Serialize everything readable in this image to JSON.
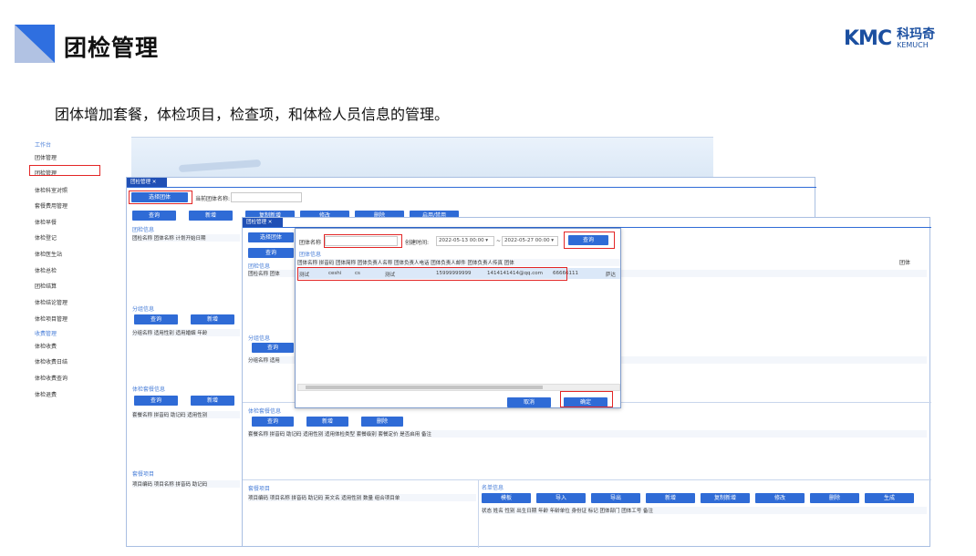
{
  "slide": {
    "title": "团检管理",
    "subtitle": "团体增加套餐，体检项目，检查项，和体检人员信息的管理。",
    "logo": {
      "mark": "KMC",
      "cn": "科玛奇",
      "en": "KEMUCH"
    }
  },
  "colors": {
    "accent": "#2f6fe0",
    "button": "#2f6bd6",
    "highlight": "#e32626"
  },
  "menu": {
    "items": [
      "工作台",
      "团体管理",
      "团检管理",
      "体检科室对照",
      "套餐费用管理",
      "体检早餐",
      "体检登记",
      "体检医生站",
      "体检总检",
      "团检结算",
      "体检结论管理",
      "体检项目管理",
      "收费管理",
      "体检收费",
      "体检收费日结",
      "体检收费查询",
      "体检退费"
    ]
  },
  "panel1": {
    "tab": "团检管理",
    "select_group_btn": "选择团体",
    "current_group_label": "当前团体名称:",
    "buttons": [
      "查询",
      "新增",
      "复制新增",
      "修改",
      "删除",
      "启用/禁用"
    ],
    "section_group_info": "团检信息",
    "group_cols": "团检名称  团体名称  计划开始日期",
    "section_sub": "分组信息",
    "sub_buttons": [
      "查询",
      "新增"
    ],
    "sub_cols": "分组名称  适用性别  适用婚姻  年龄",
    "section_pkg": "体检套餐信息",
    "pkg_buttons": [
      "查询",
      "新增"
    ],
    "pkg_cols": "套餐名称  拼音码  助记码  适用性别",
    "section_item": "套餐项目",
    "item_cols": "项目编码  项目名称  拼音码  助记码"
  },
  "panel2": {
    "tab": "团检管理",
    "select_group_btn": "选择团体",
    "query_btn": "查询",
    "section_group_info": "团检信息",
    "group_cols": "团检名称  团体",
    "section_sub": "分组信息",
    "sub_query": "查询",
    "sub_cols": "分组名称  适用",
    "section_pkg": "体检套餐信息",
    "pkg_buttons": [
      "查询",
      "新增",
      "删除"
    ],
    "pkg_cols": "套餐名称  拼音码  助记码  适用性别  适用体检类型  套餐级别  套餐定价  是否启用  备注",
    "section_item": "套餐项目",
    "item_cols": "项目编码  项目名称  拼音码  助记码  英文名  适用性别  数量  组合项目单",
    "section_list": "名单信息",
    "list_buttons": [
      "模板",
      "导入",
      "导出",
      "新增",
      "复制新增",
      "修改",
      "删除",
      "生成"
    ],
    "list_cols": "状态  姓名  性别  出生日期  年龄  年龄单位  身份证  标记  团体部门  团体工号  备注",
    "right_col": "团体"
  },
  "dialog": {
    "group_name_label": "团体名称",
    "create_time_label": "创建时间:",
    "date_from": "2022-05-13 00:00",
    "date_to": "2022-05-27 00:00",
    "tilde": "~",
    "query_btn": "查询",
    "section": "团体信息",
    "cols": "团体名称  拼音码  团体简称  团体负责人名称  团体负责人电话  团体负责人邮件  团体负责人传真  团体",
    "row": [
      "测试",
      "ceshi",
      "cs",
      "测试",
      "15999999999",
      "1414141414@qq.com",
      "66666111",
      "萨达"
    ],
    "cancel_btn": "取消",
    "ok_btn": "确定"
  }
}
